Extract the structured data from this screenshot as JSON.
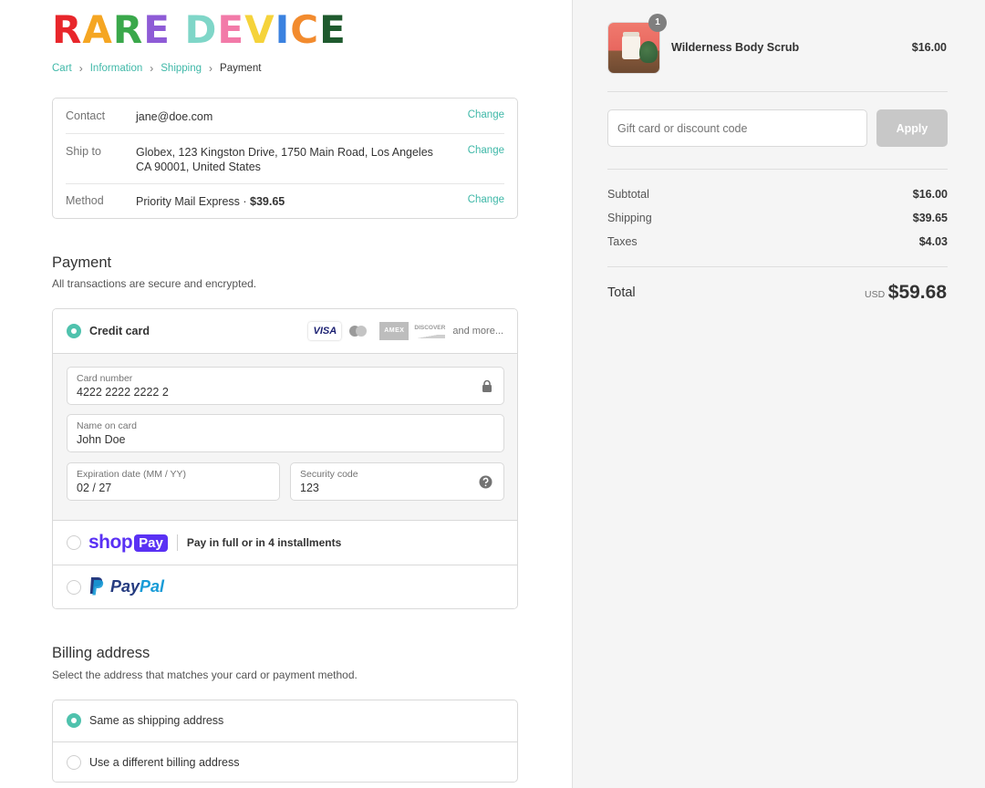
{
  "store": {
    "logo_letters": [
      {
        "ch": "R",
        "color": "#e8262b"
      },
      {
        "ch": "A",
        "color": "#f5a623"
      },
      {
        "ch": "R",
        "color": "#3aa84b"
      },
      {
        "ch": "E",
        "color": "#8e5bd6"
      },
      {
        "ch": " ",
        "color": "#ffffff"
      },
      {
        "ch": "D",
        "color": "#7fd6c8"
      },
      {
        "ch": "E",
        "color": "#f27aa8"
      },
      {
        "ch": "V",
        "color": "#f5d33b"
      },
      {
        "ch": "I",
        "color": "#3b82e0"
      },
      {
        "ch": "C",
        "color": "#f28b2e"
      },
      {
        "ch": "E",
        "color": "#1f5a2e"
      }
    ],
    "accent_color": "#3fb8a8"
  },
  "breadcrumb": {
    "cart": "Cart",
    "information": "Information",
    "shipping": "Shipping",
    "payment": "Payment",
    "separator": "›"
  },
  "review": {
    "contact_label": "Contact",
    "contact_value": "jane@doe.com",
    "ship_label": "Ship to",
    "ship_value": "Globex, 123 Kingston Drive, 1750 Main Road, Los Angeles CA 90001, United States",
    "method_label": "Method",
    "method_value": "Priority Mail Express · ",
    "method_price": "$39.65",
    "change_label": "Change"
  },
  "payment": {
    "title": "Payment",
    "subtitle": "All transactions are secure and encrypted.",
    "credit_card_label": "Credit card",
    "card_brands": {
      "visa": "VISA",
      "amex": "AMEX",
      "discover": "DISCOVER",
      "more": "and more..."
    },
    "fields": {
      "card_number_label": "Card number",
      "card_number_value": "4222 2222 2222 2",
      "name_label": "Name on card",
      "name_value": "John Doe",
      "expiry_label": "Expiration date (MM / YY)",
      "expiry_value": "02 / 27",
      "cvv_label": "Security code",
      "cvv_value": "123"
    },
    "shoppay": {
      "shop": "shop",
      "pay": "Pay",
      "text": "Pay in full or in 4 installments"
    },
    "paypal": {
      "pay": "Pay",
      "pal": "Pal"
    }
  },
  "billing": {
    "title": "Billing address",
    "subtitle": "Select the address that matches your card or payment method.",
    "same_label": "Same as shipping address",
    "different_label": "Use a different billing address"
  },
  "summary": {
    "product_name": "Wilderness Body Scrub",
    "product_price": "$16.00",
    "quantity": "1",
    "discount_placeholder": "Gift card or discount code",
    "apply_label": "Apply",
    "subtotal_label": "Subtotal",
    "subtotal_value": "$16.00",
    "shipping_label": "Shipping",
    "shipping_value": "$39.65",
    "taxes_label": "Taxes",
    "taxes_value": "$4.03",
    "total_label": "Total",
    "currency": "USD",
    "total_value": "$59.68"
  }
}
